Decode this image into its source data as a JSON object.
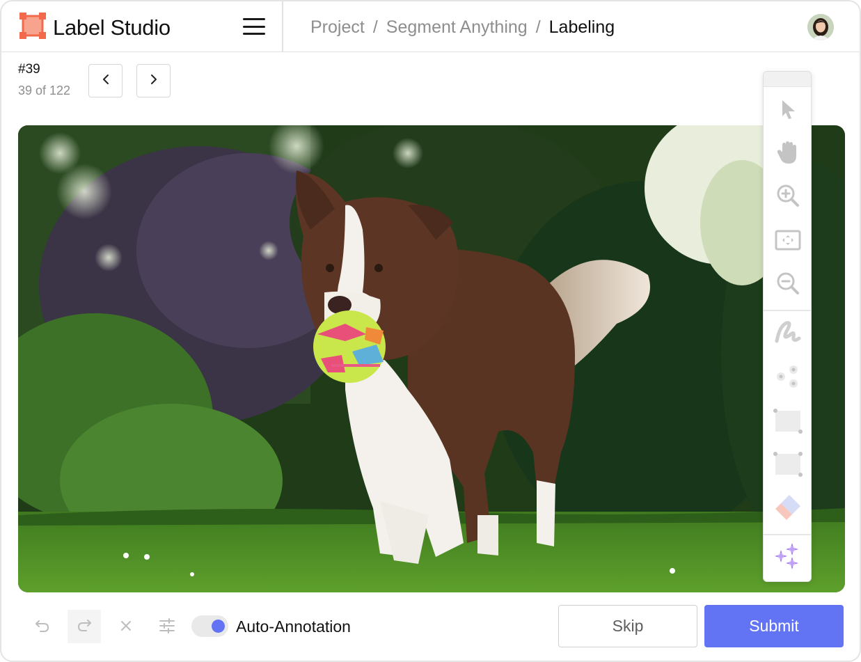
{
  "app": {
    "name": "Label Studio",
    "brand_color": "#F26A4B"
  },
  "breadcrumb": {
    "items": [
      "Project",
      "Segment Anything"
    ],
    "separator": "/",
    "current": "Labeling"
  },
  "task": {
    "id_label": "#39",
    "position_label": "39 of 122"
  },
  "image": {
    "description_icon": "photo-of-dog-with-ball"
  },
  "toolbar": {
    "tools": [
      {
        "name": "select-tool",
        "icon": "cursor-arrow-icon"
      },
      {
        "name": "pan-tool",
        "icon": "hand-icon"
      },
      {
        "name": "zoom-in-tool",
        "icon": "zoom-in-icon"
      },
      {
        "name": "zoom-to-fit-tool",
        "icon": "fit-to-screen-icon"
      },
      {
        "name": "zoom-out-tool",
        "icon": "zoom-out-icon"
      },
      {
        "name": "brush-tool",
        "icon": "brush-squiggle-icon"
      },
      {
        "name": "keypoint-tool",
        "icon": "keypoints-icon"
      },
      {
        "name": "rectangle-tool",
        "icon": "rectangle-icon"
      },
      {
        "name": "rectangle-3point-tool",
        "icon": "rectangle-3point-icon"
      },
      {
        "name": "eraser-tool",
        "icon": "eraser-icon"
      },
      {
        "name": "auto-annotation-tool",
        "icon": "sparkles-icon"
      }
    ]
  },
  "bottom_bar": {
    "auto_annotation_label": "Auto-Annotation",
    "auto_annotation_enabled": true,
    "skip_label": "Skip",
    "submit_label": "Submit",
    "accent_color": "#6274F4"
  }
}
